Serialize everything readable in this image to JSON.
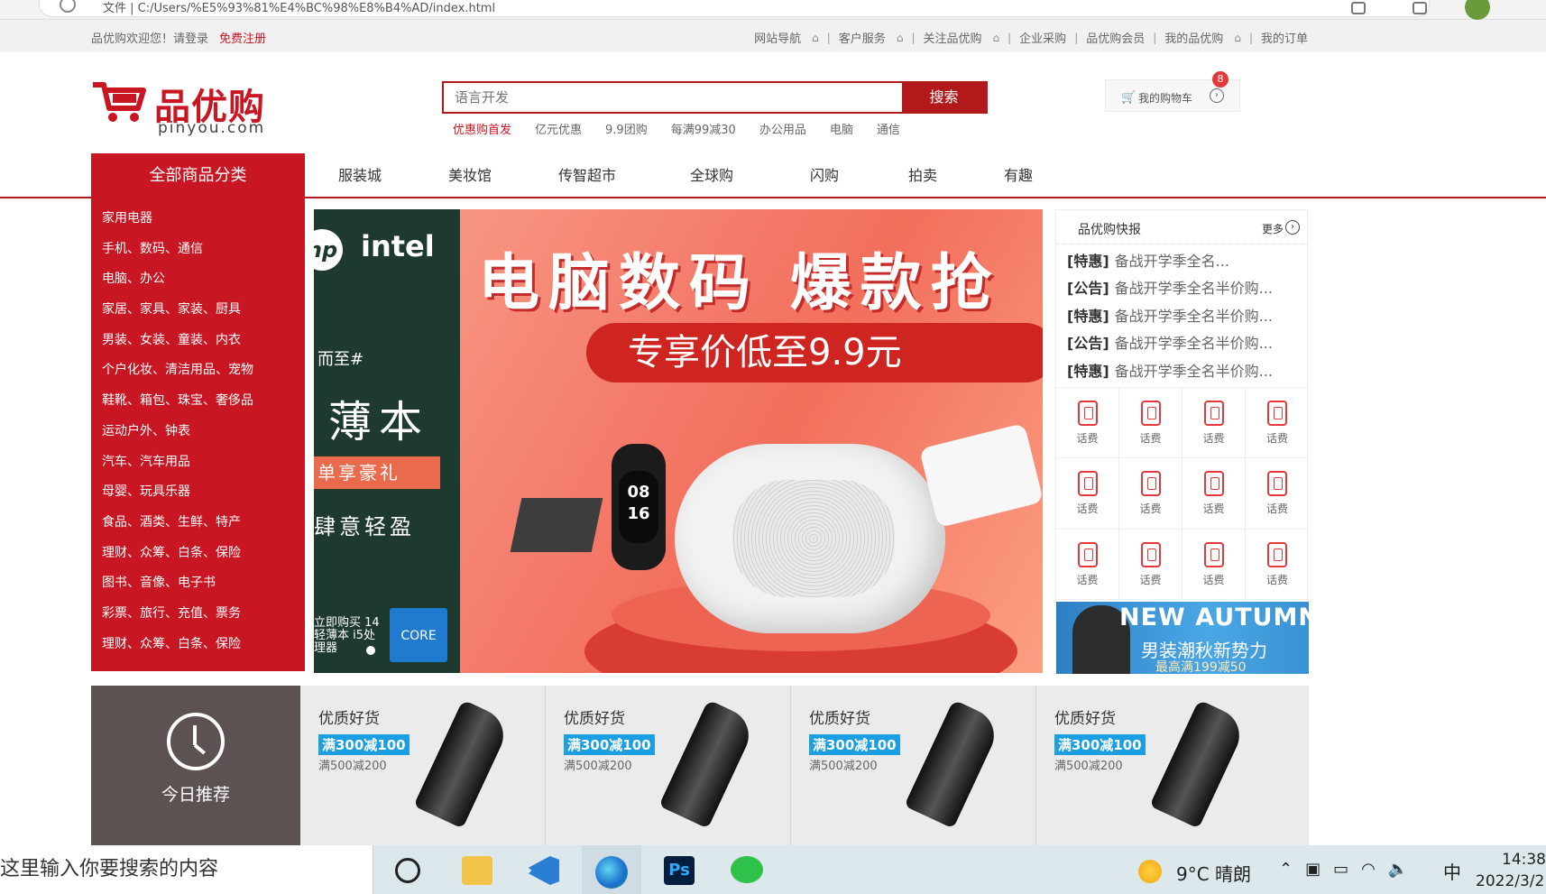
{
  "browser": {
    "address": "文件 | C:/Users/%E5%93%81%E4%BC%98%E8%B4%AD/index.html"
  },
  "shortcut": {
    "welcome": "品优购欢迎您！请登录",
    "register": "免费注册",
    "links": [
      "网站导航",
      "客户服务",
      "关注品优购",
      "企业采购",
      "品优购会员",
      "我的品优购",
      "我的订单"
    ]
  },
  "logo": {
    "cn": "品优购",
    "en": "pinyou.com"
  },
  "search": {
    "placeholder": "语言开发",
    "button": "搜索",
    "hotwords": [
      "优惠购首发",
      "亿元优惠",
      "9.9团购",
      "每满99减30",
      "办公用品",
      "电脑",
      "通信"
    ]
  },
  "cart": {
    "label": "我的购物车",
    "count": "8"
  },
  "nav": {
    "all_categories": "全部商品分类",
    "items": [
      "服装城",
      "美妆馆",
      "传智超市",
      "全球购",
      "闪购",
      "拍卖",
      "有趣"
    ]
  },
  "categories": [
    "家用电器",
    "手机、数码、通信",
    "电脑、办公",
    "家居、家具、家装、厨具",
    "男装、女装、童装、内衣",
    "个户化妆、清洁用品、宠物",
    "鞋靴、箱包、珠宝、奢侈品",
    "运动户外、钟表",
    "汽车、汽车用品",
    "母婴、玩具乐器",
    "食品、酒类、生鲜、特产",
    "理财、众筹、白条、保险",
    "图书、音像、电子书",
    "彩票、旅行、充值、票务",
    "理财、众筹、白条、保险"
  ],
  "banner": {
    "brand": "intel",
    "left_line1": "而至#",
    "left_line2": "薄本",
    "left_line3": "单享豪礼",
    "left_line4": "肆意轻盈",
    "left_line5": "立即购买 14轻薄本 i5处理器",
    "core": "CORE",
    "headline": "电脑数码 爆款抢",
    "subline": "专享价低至9.9元",
    "watch_time": "08 16"
  },
  "news": {
    "title": "品优购快报",
    "more": "更多",
    "items": [
      {
        "tag": "[特惠]",
        "text": "备战开学季全名..."
      },
      {
        "tag": "[公告]",
        "text": "备战开学季全名半价购..."
      },
      {
        "tag": "[特惠]",
        "text": "备战开学季全名半价购..."
      },
      {
        "tag": "[公告]",
        "text": "备战开学季全名半价购..."
      },
      {
        "tag": "[特惠]",
        "text": "备战开学季全名半价购..."
      }
    ],
    "grid_label": "话费",
    "ad_title": "NEW AUTUMN",
    "ad_sub": "男装潮秋新势力",
    "ad_deal": "最高满199减50"
  },
  "recommend": {
    "title": "今日推荐",
    "items": [
      {
        "name": "优质好货",
        "badge": "满300减100",
        "deal": "满500减200"
      },
      {
        "name": "优质好货",
        "badge": "满300减100",
        "deal": "满500减200"
      },
      {
        "name": "优质好货",
        "badge": "满300减100",
        "deal": "满500减200"
      },
      {
        "name": "优质好货",
        "badge": "满300减100",
        "deal": "满500减200"
      }
    ]
  },
  "taskbar": {
    "search_placeholder": "这里输入你要搜索的内容",
    "weather": "9°C  晴朗",
    "ime": "中",
    "time": "14:38",
    "date": "2022/3/2"
  }
}
